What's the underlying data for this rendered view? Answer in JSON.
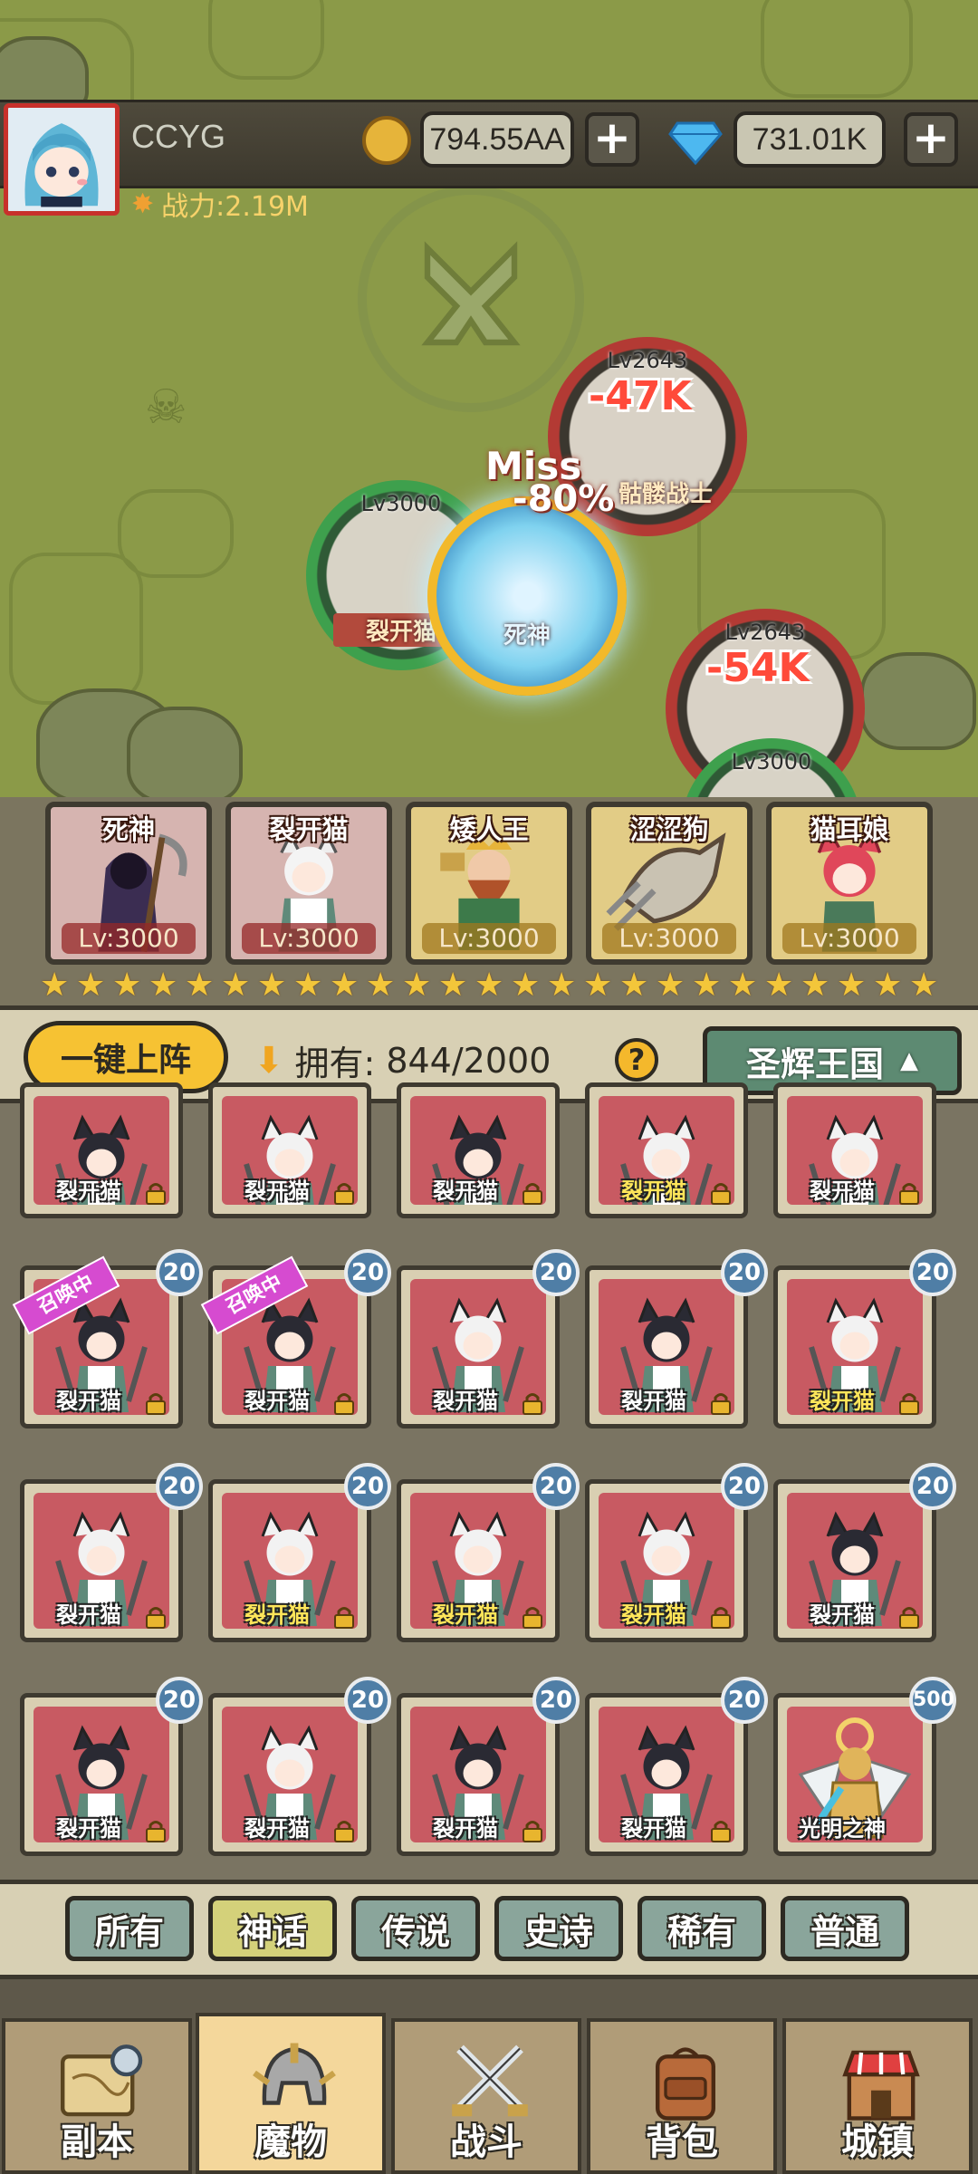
{
  "player": {
    "name": "CCYG",
    "power": "战力:2.19M",
    "gold": "794.55AA",
    "gems": "731.01K"
  },
  "battle": {
    "enemies": [
      {
        "level": "Lv2643",
        "damage": "-47K",
        "name": "骷髅战士"
      },
      {
        "level": "Lv2643",
        "damage": "-54K"
      }
    ],
    "allies": [
      {
        "level": "Lv3000",
        "name": "裂开猫"
      },
      {
        "level": "Lv3000",
        "name": "死神"
      },
      {
        "level": "Lv3000"
      }
    ],
    "effects": {
      "miss": "Miss",
      "reduction": "-80%"
    }
  },
  "deployed": [
    {
      "name": "死神",
      "level": "Lv:3000"
    },
    {
      "name": "裂开猫",
      "level": "Lv:3000"
    },
    {
      "name": "矮人王",
      "level": "Lv:3000"
    },
    {
      "name": "涩涩狗",
      "level": "Lv:3000"
    },
    {
      "name": "猫耳娘",
      "level": "Lv:3000"
    }
  ],
  "controls": {
    "deploy_all": "一键上阵",
    "owned_label": "拥有:",
    "owned_value": "844/2000",
    "help": "?",
    "kingdom": "圣辉王国"
  },
  "collection": [
    {
      "name": "裂开猫",
      "badge": "",
      "summoning": false,
      "name_color": "white"
    },
    {
      "name": "裂开猫",
      "badge": "",
      "summoning": false,
      "name_color": "white"
    },
    {
      "name": "裂开猫",
      "badge": "",
      "summoning": false,
      "name_color": "white"
    },
    {
      "name": "裂开猫",
      "badge": "",
      "summoning": false,
      "name_color": "yellow"
    },
    {
      "name": "裂开猫",
      "badge": "",
      "summoning": false,
      "name_color": "white"
    },
    {
      "name": "裂开猫",
      "badge": "20",
      "summoning": true,
      "name_color": "white"
    },
    {
      "name": "裂开猫",
      "badge": "20",
      "summoning": true,
      "name_color": "white"
    },
    {
      "name": "裂开猫",
      "badge": "20",
      "summoning": false,
      "name_color": "white"
    },
    {
      "name": "裂开猫",
      "badge": "20",
      "summoning": false,
      "name_color": "white"
    },
    {
      "name": "裂开猫",
      "badge": "20",
      "summoning": false,
      "name_color": "yellow"
    },
    {
      "name": "裂开猫",
      "badge": "20",
      "summoning": false,
      "name_color": "white"
    },
    {
      "name": "裂开猫",
      "badge": "20",
      "summoning": false,
      "name_color": "yellow"
    },
    {
      "name": "裂开猫",
      "badge": "20",
      "summoning": false,
      "name_color": "yellow"
    },
    {
      "name": "裂开猫",
      "badge": "20",
      "summoning": false,
      "name_color": "yellow"
    },
    {
      "name": "裂开猫",
      "badge": "20",
      "summoning": false,
      "name_color": "white"
    },
    {
      "name": "裂开猫",
      "badge": "20",
      "summoning": false,
      "name_color": "white"
    },
    {
      "name": "裂开猫",
      "badge": "20",
      "summoning": false,
      "name_color": "white"
    },
    {
      "name": "裂开猫",
      "badge": "20",
      "summoning": false,
      "name_color": "white"
    },
    {
      "name": "裂开猫",
      "badge": "20",
      "summoning": false,
      "name_color": "white"
    },
    {
      "name": "光明之神",
      "badge": "500",
      "summoning": false,
      "name_color": "white"
    }
  ],
  "summon_tag": "召唤中",
  "filters": [
    "所有",
    "神话",
    "传说",
    "史诗",
    "稀有",
    "普通"
  ],
  "active_filter": "神话",
  "nav": [
    "副本",
    "魔物",
    "战斗",
    "背包",
    "城镇"
  ],
  "active_nav": "魔物",
  "colors": {
    "accent_gold": "#f6c233",
    "badge_blue": "#4f7ea6",
    "summon_pink": "#d64bd0",
    "portrait_red": "#c85a62"
  }
}
